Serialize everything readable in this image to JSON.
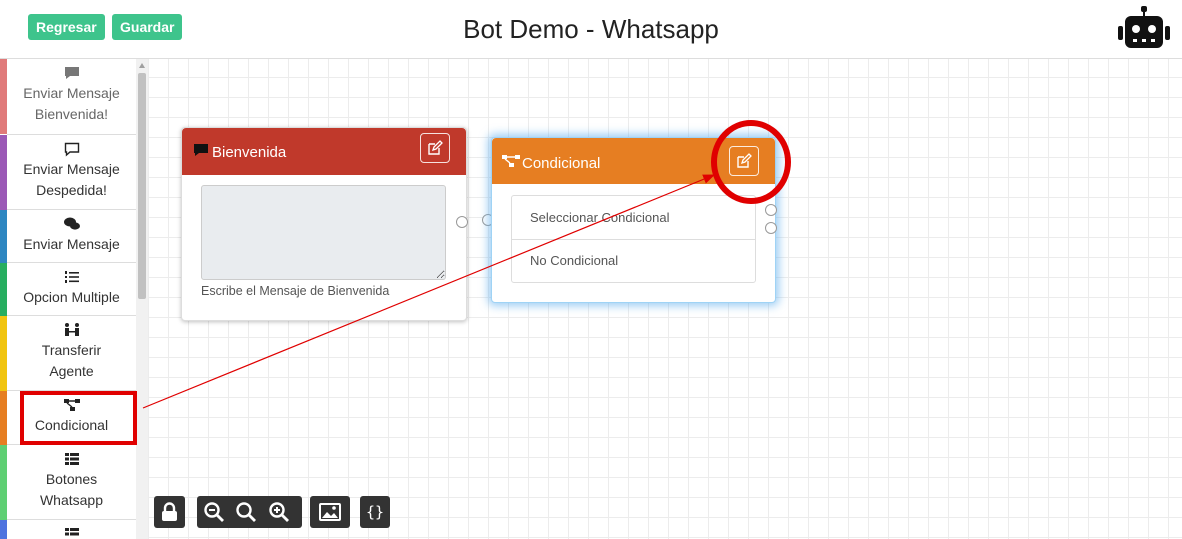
{
  "header": {
    "back_label": "Regresar",
    "save_label": "Guardar",
    "title": "Bot Demo - Whatsapp",
    "bot_icon": "robot-icon"
  },
  "sidebar": {
    "items": [
      {
        "icon": "comment-icon",
        "line1": "Enviar Mensaje",
        "line2": "Bienvenida!",
        "color": "#e07a7a"
      },
      {
        "icon": "comment-outline-icon",
        "line1": "Enviar Mensaje",
        "line2": "Despedida!",
        "color": "#9b59b6"
      },
      {
        "icon": "comments-icon",
        "line1": "Enviar Mensaje",
        "line2": "",
        "color": "#2e86c1"
      },
      {
        "icon": "list-ol-icon",
        "line1": "Opcion Multiple",
        "line2": "",
        "color": "#27ae60"
      },
      {
        "icon": "people-arrows-icon",
        "line1": "Transferir",
        "line2": "Agente",
        "color": "#f1c40f"
      },
      {
        "icon": "project-diagram-icon",
        "line1": "Condicional",
        "line2": "",
        "color": "#e67e22"
      },
      {
        "icon": "th-list-icon",
        "line1": "Botones",
        "line2": "Whatsapp",
        "color": "#5ecf73"
      },
      {
        "icon": "th-list-icon",
        "line1": "",
        "line2": "",
        "color": "#4e73df"
      }
    ]
  },
  "nodes": {
    "bienvenida": {
      "title": "Bienvenida",
      "color": "#c0392b",
      "textarea_value": "",
      "help_text": "Escribe el Mensaje de Bienvenida"
    },
    "condicional": {
      "title": "Condicional",
      "color": "#e67e22",
      "options": [
        "Seleccionar Condicional",
        "No Condicional"
      ]
    }
  },
  "toolbar": {
    "buttons": [
      "lock-icon",
      "zoom-out-icon",
      "zoom-reset-icon",
      "zoom-in-icon",
      "image-icon",
      "code-icon"
    ],
    "code_label": "{}"
  },
  "annotation_color": "#e00000"
}
